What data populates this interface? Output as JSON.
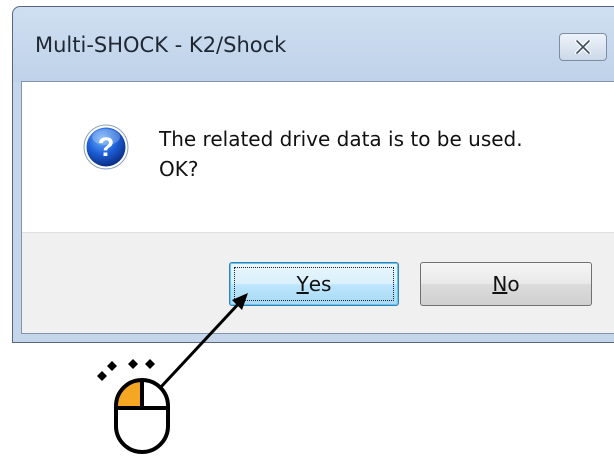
{
  "window": {
    "title": "Multi-SHOCK - K2/Shock",
    "close_icon": "close-icon"
  },
  "message": {
    "icon": "question-icon",
    "line1": "The related drive data is to be used.",
    "line2": "OK?"
  },
  "buttons": {
    "yes_mnemonic": "Y",
    "yes_rest": "es",
    "no_mnemonic": "N",
    "no_rest": "o"
  },
  "annotation": {
    "cursor_icon": "mouse-click-icon",
    "arrow_icon": "arrow-icon",
    "accent_color": "#f5a623"
  }
}
